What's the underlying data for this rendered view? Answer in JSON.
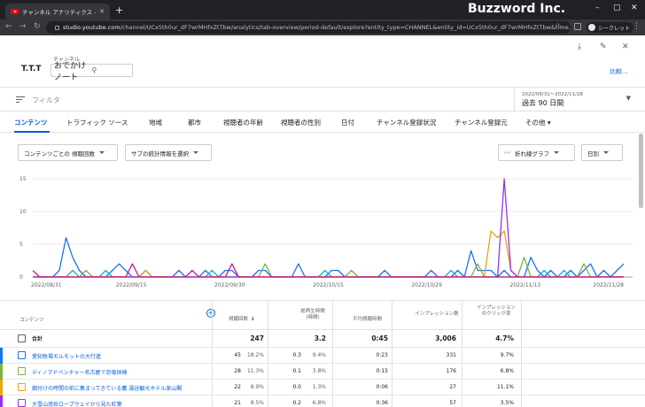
{
  "browser": {
    "tab_title": "チャンネル アナリティクス - YouTube S",
    "brand_overlay": "Buzzword Inc.",
    "url_host": "studio.youtube.com",
    "url_path": "/channel/UCx5th0ur_dF7wrMHfxZtTbw/analytics/tab-overview/period-default/explore?entity_type=CHANNEL&entity_id=UCx5th0ur_dF7wrMHfxZtTbw&time...",
    "incognito_label": "シークレット"
  },
  "header": {
    "channel_logo": "T.T.T",
    "channel_label": "チャンネル",
    "channel_name": "おでかけノート",
    "compare_label": "比較..."
  },
  "filter": {
    "placeholder": "フィルタ",
    "period_range": "2022/08/31～2022/11/28",
    "period_name": "過去 90 日間"
  },
  "tabs": [
    "コンテンツ",
    "トラフィック ソース",
    "地域",
    "都市",
    "視聴者の年齢",
    "視聴者の性別",
    "日付",
    "チャンネル登録状況",
    "チャンネル登録元",
    "その他"
  ],
  "controls": {
    "metric_select": "コンテンツごとの 視聴回数",
    "secondary_select": "サブの統計情報を選択",
    "chart_type": "折れ線グラフ",
    "granularity": "日別"
  },
  "chart_data": {
    "type": "line",
    "x_ticks": [
      "2022/08/31",
      "2022/09/15",
      "2022/09/30",
      "2022/10/15",
      "2022/10/29",
      "2022/11/13",
      "2022/11/28"
    ],
    "y_ticks": [
      0,
      5,
      10,
      15
    ],
    "ylim": [
      0,
      15
    ],
    "days": 90,
    "series": [
      {
        "color": "#1a73e8",
        "values": [
          0,
          0,
          0,
          0,
          1,
          6,
          3,
          1,
          0,
          0,
          0,
          0,
          1,
          2,
          1,
          0,
          0,
          1,
          0,
          0,
          0,
          0,
          1,
          0,
          0,
          0,
          1,
          0,
          0,
          1,
          1,
          0,
          0,
          0,
          1,
          1,
          0,
          0,
          0,
          0,
          2,
          0,
          0,
          0,
          0,
          1,
          1,
          0,
          0,
          0,
          0,
          0,
          0,
          1,
          0,
          0,
          0,
          0,
          0,
          0,
          1,
          0,
          0,
          0,
          1,
          0,
          4,
          1,
          1,
          1,
          0,
          1,
          0,
          0,
          0,
          3,
          1,
          0,
          1,
          0,
          0,
          1,
          0,
          1,
          2,
          0,
          1,
          0,
          1,
          2
        ]
      },
      {
        "color": "#12b5cb",
        "values": [
          0,
          0,
          0,
          0,
          0,
          0,
          1,
          0,
          0,
          0,
          0,
          1,
          0,
          0,
          0,
          0,
          0,
          0,
          0,
          0,
          0,
          0,
          0,
          0,
          0,
          0,
          0,
          1,
          0,
          0,
          0,
          0,
          0,
          0,
          0,
          0,
          0,
          0,
          0,
          0,
          0,
          0,
          0,
          0,
          1,
          0,
          0,
          0,
          0,
          0,
          0,
          0,
          0,
          0,
          0,
          0,
          0,
          0,
          0,
          0,
          0,
          0,
          0,
          1,
          0,
          0,
          0,
          0,
          0,
          0,
          0,
          0,
          0,
          0,
          0,
          0,
          0,
          1,
          0,
          0,
          1,
          0,
          0,
          0,
          0,
          0,
          0,
          0,
          0,
          0
        ]
      },
      {
        "color": "#7cb342",
        "values": [
          0,
          0,
          0,
          0,
          0,
          0,
          0,
          0,
          1,
          0,
          0,
          0,
          0,
          0,
          0,
          0,
          0,
          0,
          0,
          0,
          0,
          0,
          0,
          0,
          0,
          0,
          0,
          0,
          0,
          0,
          0,
          0,
          0,
          0,
          0,
          2,
          0,
          0,
          0,
          0,
          0,
          0,
          0,
          0,
          0,
          0,
          0,
          0,
          1,
          0,
          0,
          0,
          0,
          0,
          0,
          0,
          0,
          0,
          0,
          0,
          0,
          0,
          0,
          0,
          0,
          0,
          0,
          2,
          0,
          0,
          0,
          0,
          0,
          0,
          3,
          0,
          0,
          0,
          0,
          0,
          0,
          0,
          0,
          2,
          0,
          0,
          0,
          0,
          0,
          0
        ]
      },
      {
        "color": "#e8a317",
        "values": [
          0,
          0,
          0,
          0,
          0,
          0,
          0,
          0,
          0,
          0,
          0,
          0,
          0,
          0,
          0,
          0,
          0,
          1,
          0,
          0,
          0,
          0,
          0,
          0,
          0,
          0,
          0,
          0,
          0,
          0,
          0,
          0,
          0,
          0,
          0,
          0,
          0,
          0,
          0,
          0,
          0,
          0,
          0,
          0,
          0,
          0,
          0,
          0,
          0,
          0,
          0,
          0,
          0,
          0,
          0,
          0,
          0,
          0,
          0,
          0,
          0,
          0,
          0,
          0,
          0,
          0,
          0,
          0,
          0,
          7,
          6,
          7,
          1,
          0,
          0,
          0,
          0,
          0,
          0,
          0,
          0,
          0,
          0,
          0,
          0,
          0,
          0,
          0,
          0,
          0
        ]
      },
      {
        "color": "#9334e6",
        "values": [
          0,
          0,
          0,
          0,
          0,
          0,
          0,
          0,
          0,
          0,
          0,
          0,
          0,
          0,
          0,
          0,
          0,
          0,
          0,
          0,
          0,
          0,
          0,
          0,
          0,
          0,
          0,
          0,
          0,
          0,
          0,
          0,
          0,
          0,
          0,
          0,
          0,
          0,
          0,
          0,
          0,
          0,
          0,
          0,
          0,
          0,
          0,
          0,
          0,
          0,
          0,
          0,
          0,
          0,
          0,
          0,
          0,
          0,
          0,
          0,
          0,
          0,
          0,
          0,
          0,
          0,
          0,
          0,
          0,
          0,
          0,
          15,
          1,
          0,
          0,
          0,
          0,
          0,
          0,
          0,
          0,
          0,
          0,
          0,
          0,
          0,
          0,
          0,
          0,
          0
        ]
      },
      {
        "color": "#d01884",
        "values": [
          1,
          0,
          0,
          0,
          0,
          0,
          0,
          0,
          0,
          0,
          0,
          0,
          0,
          0,
          0,
          2,
          0,
          0,
          0,
          0,
          0,
          0,
          0,
          0,
          1,
          0,
          0,
          0,
          0,
          0,
          2,
          0,
          0,
          0,
          0,
          0,
          0,
          0,
          0,
          0,
          0,
          0,
          0,
          0,
          0,
          0,
          0,
          0,
          0,
          0,
          0,
          0,
          0,
          0,
          0,
          0,
          0,
          0,
          0,
          0,
          0,
          0,
          0,
          0,
          0,
          0,
          0,
          0,
          0,
          0,
          0,
          0,
          0,
          0,
          0,
          0,
          0,
          0,
          0,
          0,
          0,
          0,
          0,
          0,
          0,
          0,
          0,
          0,
          0,
          0
        ]
      }
    ]
  },
  "table": {
    "headers": {
      "content": "コンテンツ",
      "views": "視聴回数",
      "watch_time": "総再生時間\n(時間)",
      "avg_duration": "平均視聴時間",
      "impressions": "インプレッション数",
      "ctr": "インプレッションのクリック率"
    },
    "total": {
      "label": "合計",
      "views": "247",
      "watch_time": "3.2",
      "avg_duration": "0:45",
      "impressions": "3,006",
      "ctr": "4.7%"
    },
    "rows": [
      {
        "color": "#1a73e8",
        "title": "愛知牧場モルモットの大行進",
        "views": "45",
        "views_pct": "18.2%",
        "watch": "0.3",
        "watch_pct": "9.4%",
        "avg": "0:23",
        "impressions": "331",
        "ctr": "9.7%"
      },
      {
        "color": "#7cb342",
        "title": "ディノアドベンチャー名古屋で恐竜探検",
        "views": "28",
        "views_pct": "11.3%",
        "watch": "0.1",
        "watch_pct": "3.8%",
        "avg": "0:15",
        "impressions": "176",
        "ctr": "6.8%"
      },
      {
        "color": "#e8a317",
        "title": "餌付けの時間の前に集まってきている鷹 湯谷観光ホテル泉山閣",
        "views": "22",
        "views_pct": "8.9%",
        "watch": "0.0",
        "watch_pct": "1.3%",
        "avg": "0:06",
        "impressions": "27",
        "ctr": "11.1%"
      },
      {
        "color": "#9334e6",
        "title": "大雪山旭岳ロープウェイから見た紅葉",
        "views": "21",
        "views_pct": "8.5%",
        "watch": "0.2",
        "watch_pct": "6.8%",
        "avg": "0:36",
        "impressions": "57",
        "ctr": "3.5%"
      }
    ]
  }
}
